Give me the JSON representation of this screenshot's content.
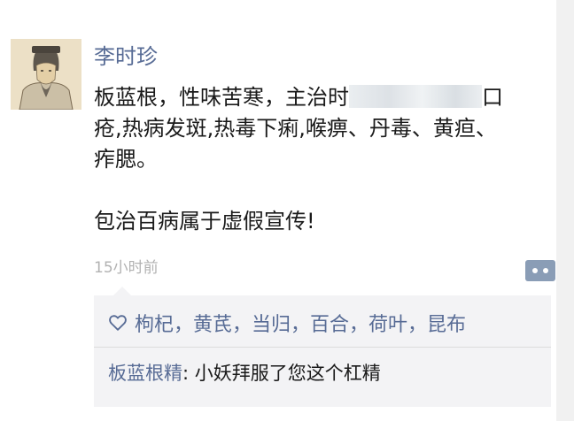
{
  "post": {
    "author": "李时珍",
    "text_line1_start": "板蓝根，性味苦寒，主治时",
    "text_line1_end": "口",
    "text_line2": "疮,热病发斑,热毒下痢,喉痹、丹毒、黄疸、",
    "text_line3": "痄腮。",
    "text_line4": "包治百病属于虚假宣传!",
    "timestamp": "15小时前"
  },
  "likes": {
    "names": "枸杞，黄芪，当归，百合，荷叶，昆布"
  },
  "comment": {
    "author": "板蓝根精",
    "separator": ": ",
    "text": "小妖拜服了您这个杠精"
  },
  "icons": {
    "like": "heart-outline-icon",
    "actions": "comment-dots-icon",
    "avatar": "portrait-avatar"
  },
  "colors": {
    "link": "#576b95",
    "text": "#1a1a1a",
    "timestamp": "#b2b2b2",
    "action_button": "#8a9db6",
    "likes_background": "#f3f3f5"
  }
}
